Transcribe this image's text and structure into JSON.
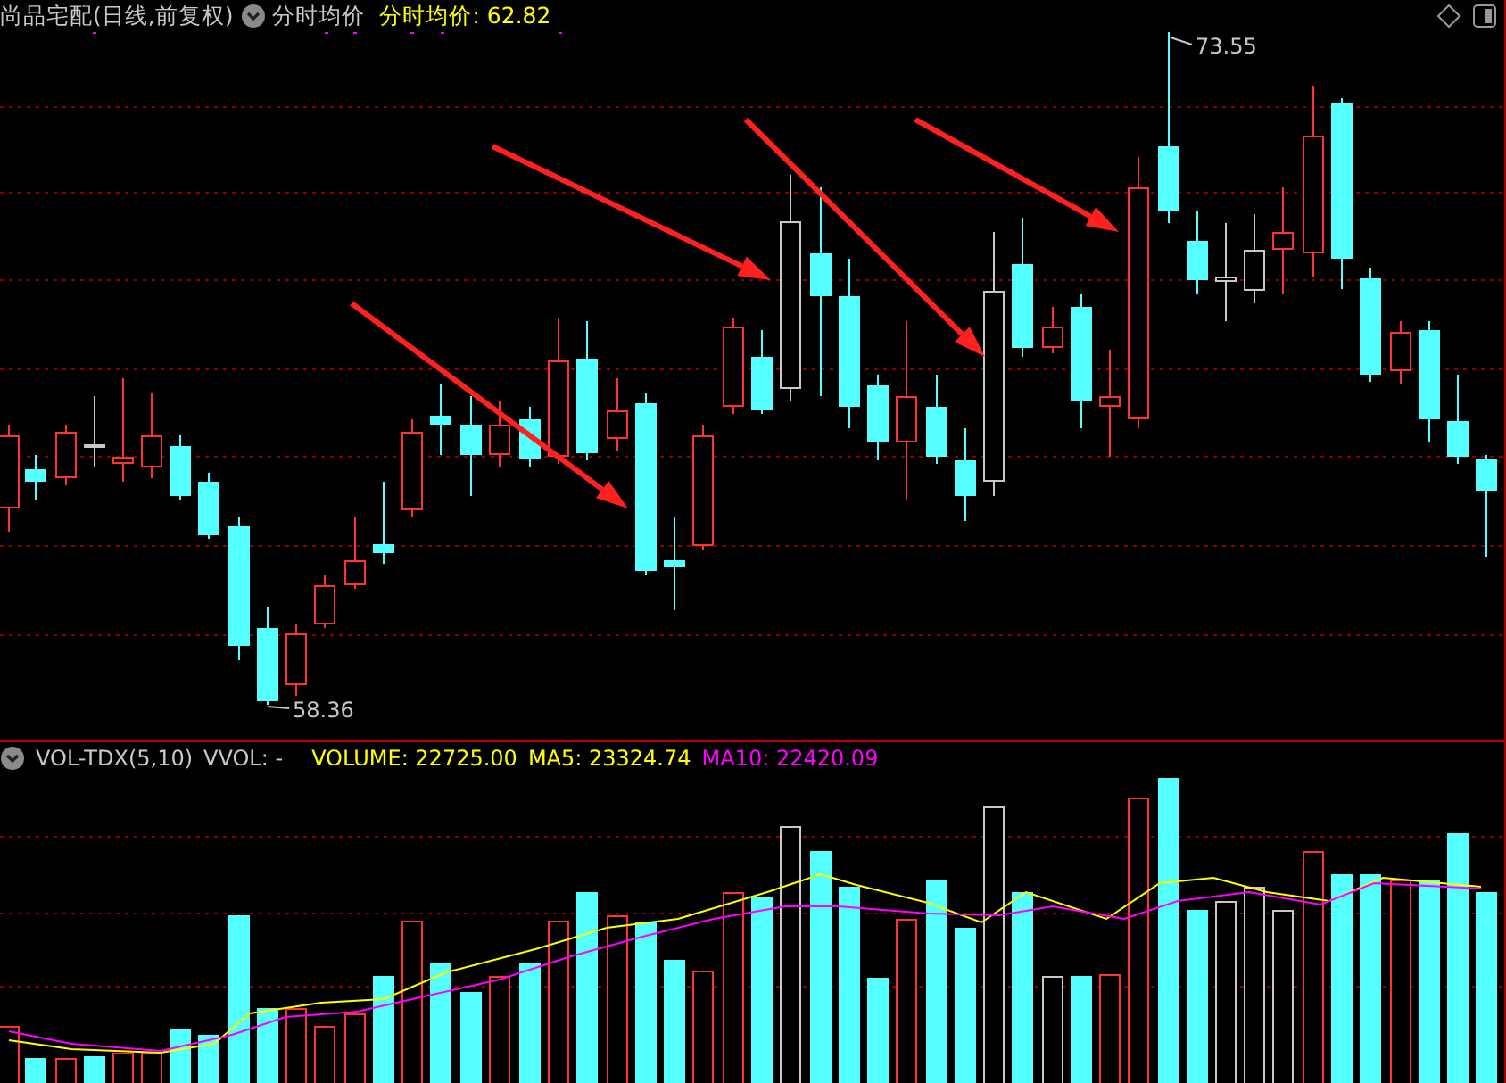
{
  "chart_header": {
    "stock_name": "尚品宅配(日线,前复权)",
    "indicator": "分时均价",
    "indicator_value": "分时均价: 62.82"
  },
  "price_chart": {
    "high_label": "73.55",
    "low_label": "58.36"
  },
  "volume_header": {
    "indicator": "VOL-TDX(5,10)",
    "vvol": "VVOL: -",
    "volume": "VOLUME: 22725.00",
    "ma5": "MA5: 23324.74",
    "ma10": "MA10: 22420.09"
  }
}
